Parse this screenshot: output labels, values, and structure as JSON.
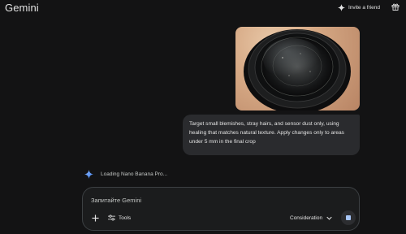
{
  "header": {
    "title": "Gemini",
    "invite_label": "Invite a friend"
  },
  "conversation": {
    "user_message": "Target small blemishes, stray hairs, and sensor dust only, using healing that matches natural texture. Apply changes only to areas under 5 mm in the final crop",
    "loading_text": "Loading Nano Banana Pro..."
  },
  "composer": {
    "placeholder": "Запитайте Gemini",
    "value": "",
    "tools_label": "Tools",
    "mode_label": "Consideration"
  },
  "colors": {
    "background": "#131314",
    "bubble": "#2a2b2e",
    "accent": "#a8c7fa"
  }
}
